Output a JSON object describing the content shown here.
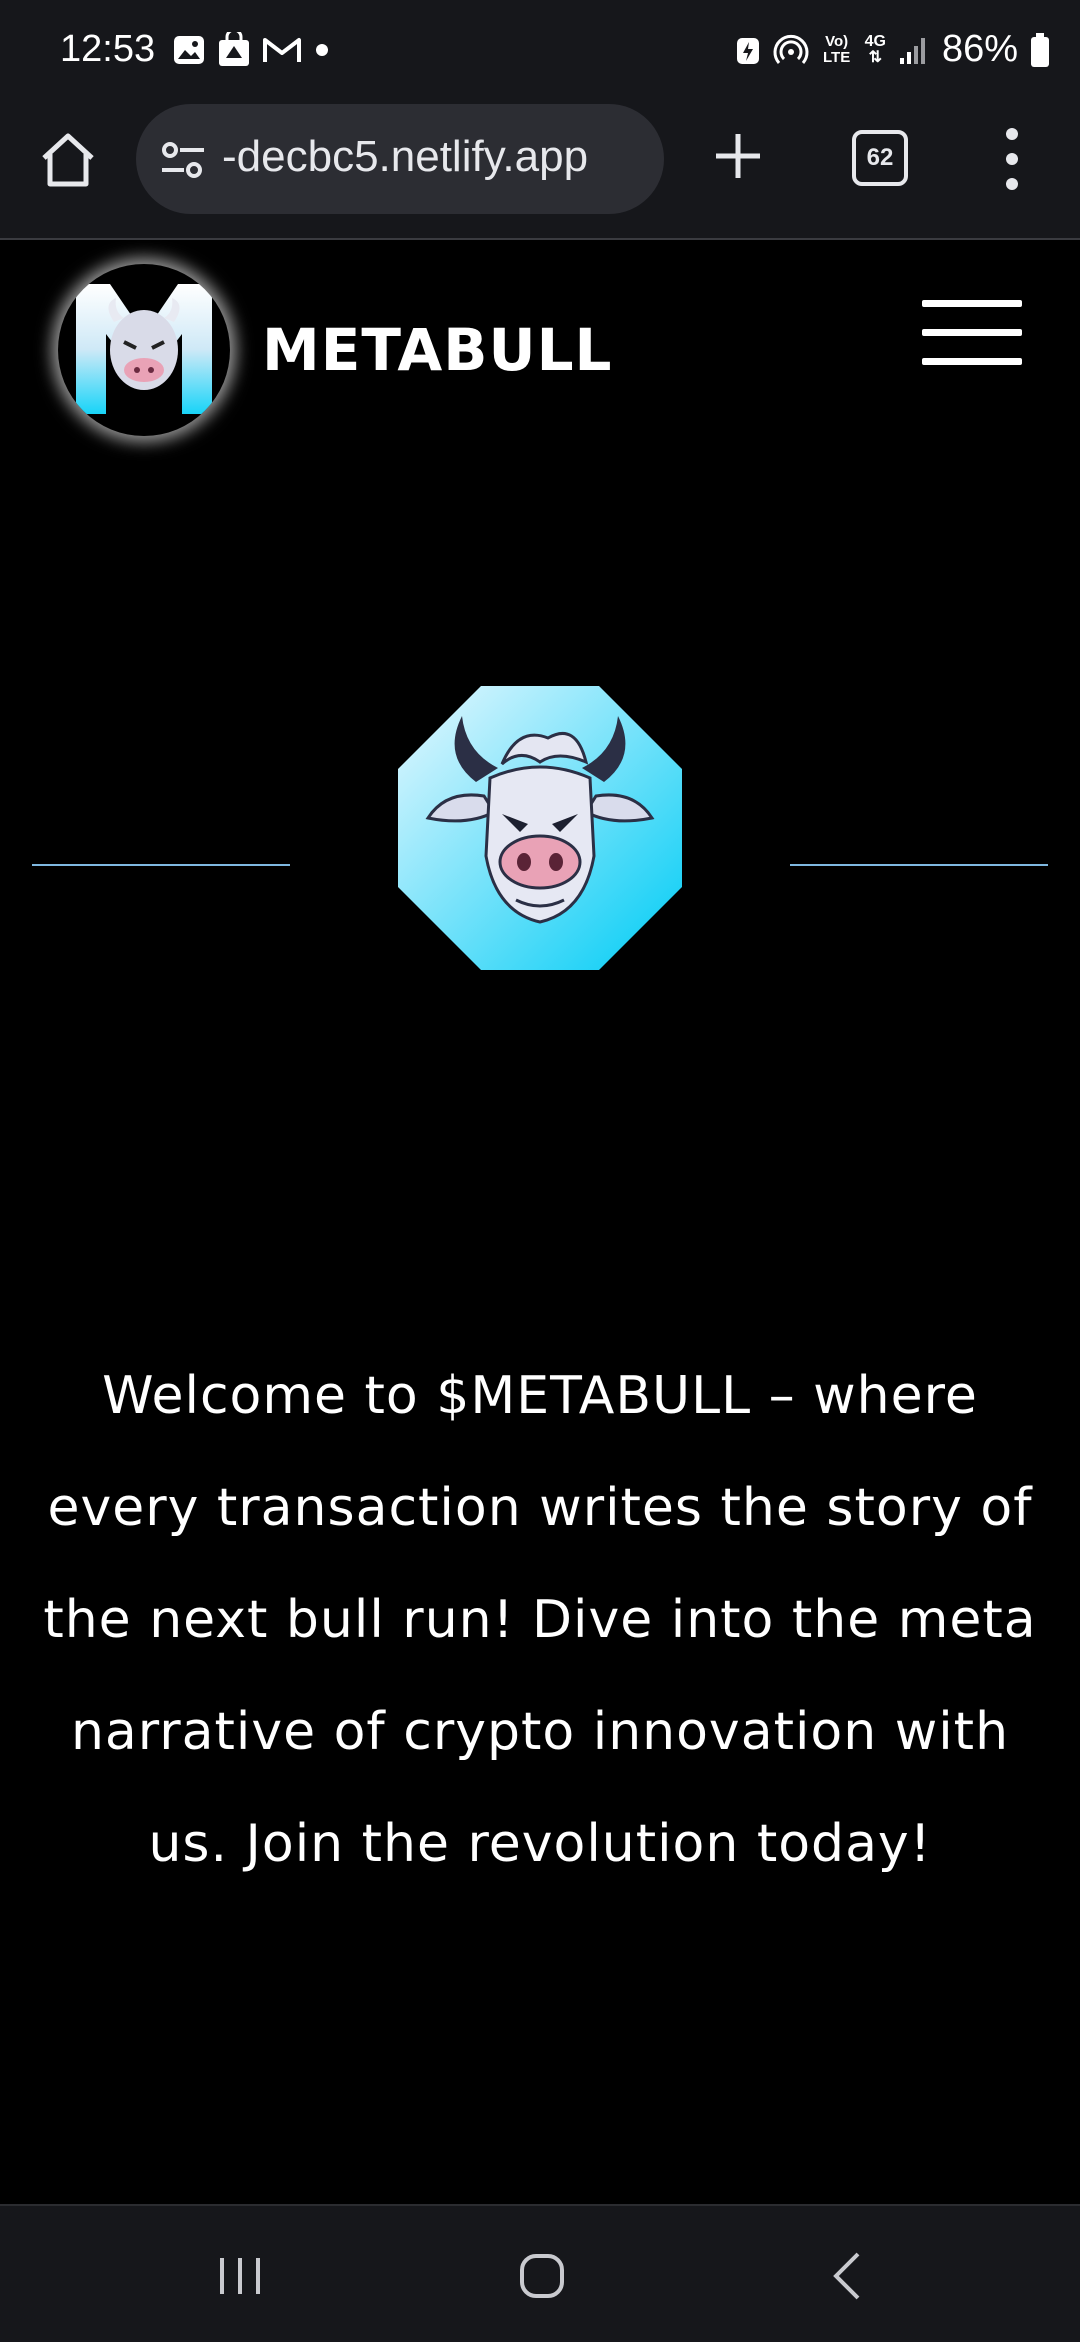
{
  "status_bar": {
    "time": "12:53",
    "battery_percent": "86%",
    "notification_icons": [
      "gallery-icon",
      "shopping-bag-icon",
      "gmail-icon",
      "dot-icon"
    ],
    "system_icons": [
      "battery-saver-icon",
      "hotspot-icon",
      "volte-icon",
      "network-4g-icon",
      "signal-icon",
      "battery-icon"
    ],
    "volte_label": "Vo) LTE",
    "network_label": "4G"
  },
  "browser": {
    "url": "-decbc5.netlify.app",
    "tab_count": "62"
  },
  "site": {
    "brand_name": "METABULL",
    "welcome_text": "Welcome to $METABULL – where every transaction writes the story of the next bull run! Dive into the meta narrative of crypto innovation with us. Join the revolution today!"
  },
  "colors": {
    "accent_cyan": "#18d4f8",
    "divider_blue": "#7fb8e0",
    "bull_pink": "#e9a2b6",
    "chrome_bg": "#16171b"
  }
}
